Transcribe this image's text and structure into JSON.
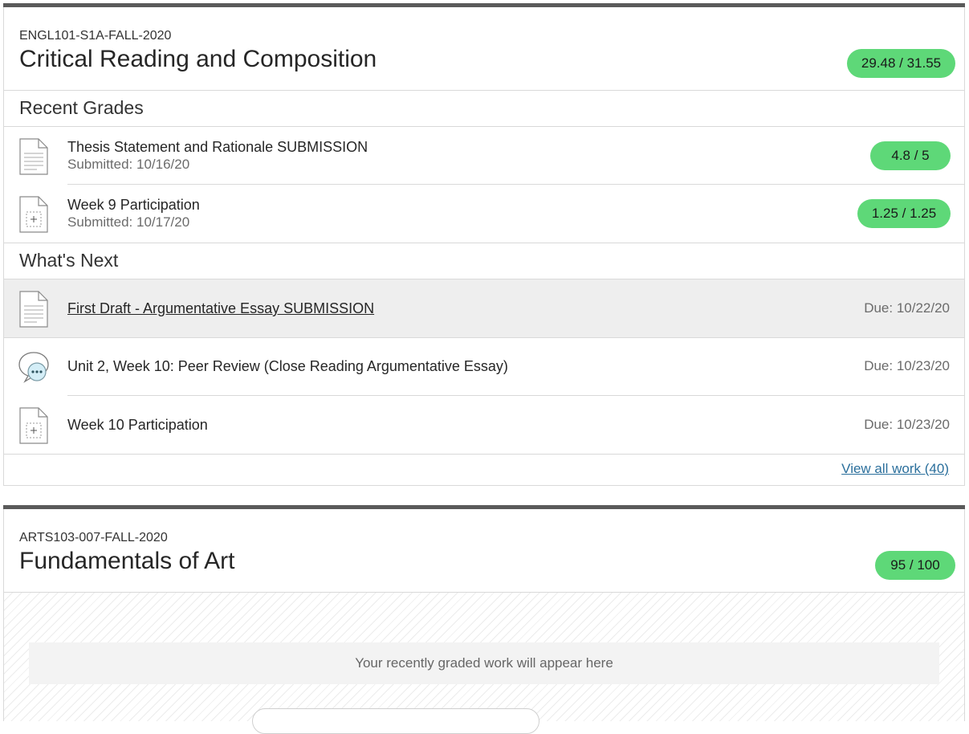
{
  "courses": [
    {
      "code": "ENGL101-S1A-FALL-2020",
      "title": "Critical Reading and Composition",
      "grade": "29.48 / 31.55",
      "recent_heading": "Recent Grades",
      "recent": [
        {
          "title": "Thesis Statement and Rationale SUBMISSION",
          "submitted": "Submitted: 10/16/20",
          "grade": "4.8 / 5",
          "icon": "document-icon"
        },
        {
          "title": "Week 9 Participation",
          "submitted": "Submitted: 10/17/20",
          "grade": "1.25 / 1.25",
          "icon": "participation-icon"
        }
      ],
      "next_heading": "What's Next",
      "next": [
        {
          "title": "First Draft - Argumentative Essay SUBMISSION",
          "due": "Due: 10/22/20",
          "icon": "document-icon"
        },
        {
          "title": "Unit 2, Week 10: Peer Review (Close Reading Argumentative Essay)",
          "due": "Due: 10/23/20",
          "icon": "discussion-icon"
        },
        {
          "title": "Week 10 Participation",
          "due": "Due: 10/23/20",
          "icon": "participation-icon"
        }
      ],
      "view_all": "View all work (40)"
    },
    {
      "code": "ARTS103-007-FALL-2020",
      "title": "Fundamentals of Art",
      "grade": "95 / 100",
      "empty_message": "Your recently graded work will appear here"
    }
  ],
  "colors": {
    "grade_pill": "#5ed878",
    "header_bar": "#5a5a5a",
    "link": "#2b6f9c"
  }
}
